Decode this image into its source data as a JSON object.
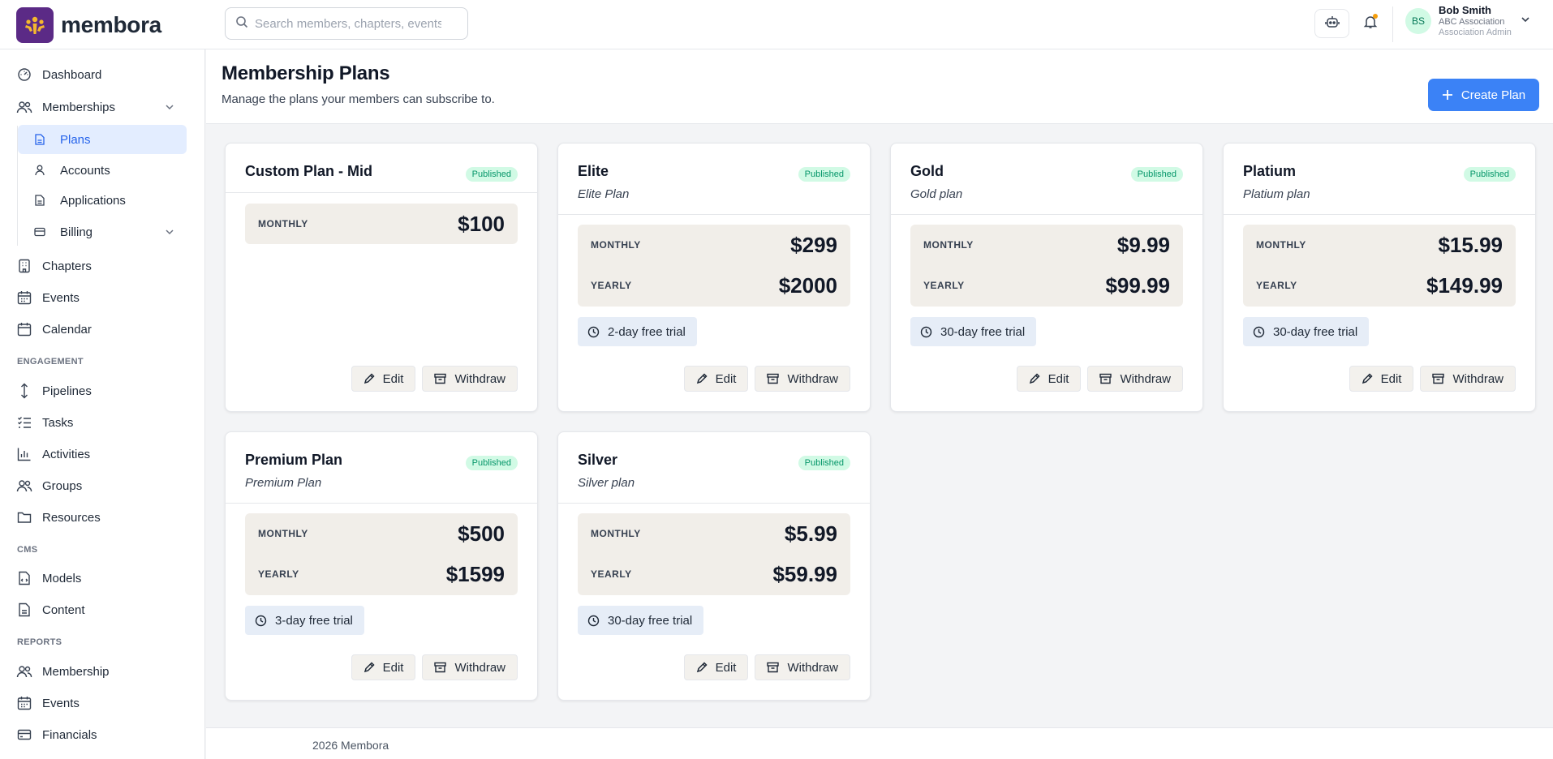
{
  "brand": {
    "name": "membora",
    "logo_icon": "people-logo-icon",
    "logo_color": "#5b2a86"
  },
  "search": {
    "placeholder": "Search members, chapters, events..."
  },
  "header": {
    "robot_icon": "robot-icon",
    "bell_icon": "bell-icon"
  },
  "user": {
    "initials": "BS",
    "name": "Bob Smith",
    "org": "ABC Association",
    "role": "Association Admin"
  },
  "sidebar": {
    "dashboard": "Dashboard",
    "memberships": "Memberships",
    "plans": "Plans",
    "accounts": "Accounts",
    "applications": "Applications",
    "billing": "Billing",
    "chapters": "Chapters",
    "events": "Events",
    "calendar": "Calendar",
    "engagement_label": "ENGAGEMENT",
    "pipelines": "Pipelines",
    "tasks": "Tasks",
    "activities": "Activities",
    "groups": "Groups",
    "resources": "Resources",
    "cms_label": "CMS",
    "models": "Models",
    "content": "Content",
    "reports_label": "REPORTS",
    "report_membership": "Membership",
    "report_events": "Events",
    "report_financials": "Financials"
  },
  "page": {
    "title": "Membership Plans",
    "subtitle": "Manage the plans your members can subscribe to.",
    "create_label": "Create Plan"
  },
  "actions": {
    "edit": "Edit",
    "withdraw": "Withdraw"
  },
  "plans": [
    {
      "name": "Custom Plan - Mid",
      "description": "",
      "status": "Published",
      "monthly_label": "MONTHLY",
      "monthly": "$100",
      "yearly_label": "",
      "yearly": "",
      "trial": ""
    },
    {
      "name": "Elite",
      "description": "Elite Plan",
      "status": "Published",
      "monthly_label": "MONTHLY",
      "monthly": "$299",
      "yearly_label": "YEARLY",
      "yearly": "$2000",
      "trial": "2-day free trial"
    },
    {
      "name": "Gold",
      "description": "Gold plan",
      "status": "Published",
      "monthly_label": "MONTHLY",
      "monthly": "$9.99",
      "yearly_label": "YEARLY",
      "yearly": "$99.99",
      "trial": "30-day free trial"
    },
    {
      "name": "Platium",
      "description": "Platium plan",
      "status": "Published",
      "monthly_label": "MONTHLY",
      "monthly": "$15.99",
      "yearly_label": "YEARLY",
      "yearly": "$149.99",
      "trial": "30-day free trial"
    },
    {
      "name": "Premium Plan",
      "description": "Premium Plan",
      "status": "Published",
      "monthly_label": "MONTHLY",
      "monthly": "$500",
      "yearly_label": "YEARLY",
      "yearly": "$1599",
      "trial": "3-day free trial"
    },
    {
      "name": "Silver",
      "description": "Silver plan",
      "status": "Published",
      "monthly_label": "MONTHLY",
      "monthly": "$5.99",
      "yearly_label": "YEARLY",
      "yearly": "$59.99",
      "trial": "30-day free trial"
    }
  ],
  "footer": {
    "text": "2026 Membora"
  },
  "colors": {
    "accent": "#3b82f6",
    "active_nav_bg": "#e3edff",
    "published_bg": "#d1fae5",
    "published_text": "#059669",
    "price_bg": "#f1eee9",
    "trial_bg": "#e6edf7"
  }
}
